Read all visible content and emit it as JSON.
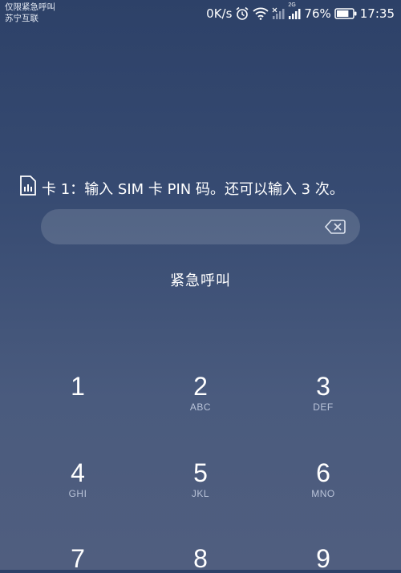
{
  "status_bar": {
    "left_lines": [
      "仅限紧急呼叫",
      "苏宁互联"
    ],
    "speed": "0K/s",
    "network_badge": "2G",
    "battery": "76%",
    "time": "17:35"
  },
  "sim_prompt": "卡 1：输入 SIM 卡 PIN 码。还可以输入 3 次。",
  "pin_field": {
    "value": "",
    "placeholder": ""
  },
  "emergency_call": "紧急呼叫",
  "keypad": [
    {
      "num": "1",
      "letters": ""
    },
    {
      "num": "2",
      "letters": "ABC"
    },
    {
      "num": "3",
      "letters": "DEF"
    },
    {
      "num": "4",
      "letters": "GHI"
    },
    {
      "num": "5",
      "letters": "JKL"
    },
    {
      "num": "6",
      "letters": "MNO"
    },
    {
      "num": "7",
      "letters": ""
    },
    {
      "num": "8",
      "letters": ""
    },
    {
      "num": "9",
      "letters": ""
    }
  ],
  "battery_level": 0.76,
  "icons": [
    "alarm-icon",
    "wifi-icon",
    "signal-icon",
    "signal-icon-2",
    "battery-icon",
    "sim-card-icon",
    "backspace-icon"
  ]
}
